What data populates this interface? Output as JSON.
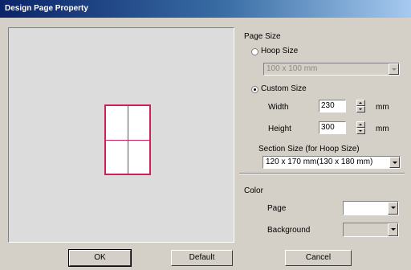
{
  "window": {
    "title": "Design Page Property"
  },
  "page_size": {
    "group_label": "Page Size",
    "hoop_size": {
      "label": "Hoop Size",
      "selected": false,
      "value": "100 x 100 mm"
    },
    "custom_size": {
      "label": "Custom Size",
      "selected": true,
      "width": {
        "label": "Width",
        "value": "230",
        "unit": "mm"
      },
      "height": {
        "label": "Height",
        "value": "300",
        "unit": "mm"
      }
    },
    "section_size": {
      "label": "Section Size (for Hoop Size)",
      "value": "120 x 170 mm(130 x 180 mm)"
    }
  },
  "color": {
    "group_label": "Color",
    "page": {
      "label": "Page",
      "value": ""
    },
    "background": {
      "label": "Background",
      "value": ""
    }
  },
  "buttons": {
    "ok": "OK",
    "default": "Default",
    "cancel": "Cancel"
  },
  "colors": {
    "title_bar": "#0a246a",
    "page_border": "#cc1f5e",
    "dialog_bg": "#d4d0c8",
    "preview_bg": "#dcdcdc"
  }
}
